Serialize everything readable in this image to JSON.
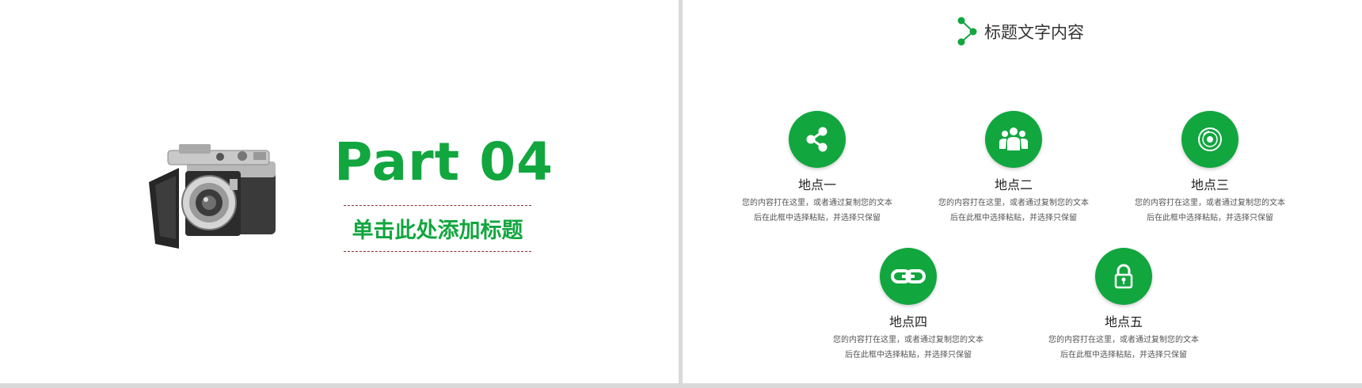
{
  "left_slide": {
    "title": "Part   04",
    "subtitle": "单击此处添加标题",
    "image": "camera-photo"
  },
  "right_slide": {
    "header_icon": "branch-nodes-icon",
    "header_title": "标题文字内容",
    "colors": {
      "accent": "#12a63f",
      "text": "#333333",
      "desc": "#555555"
    },
    "locations": [
      {
        "icon": "share-icon",
        "title": "地点一",
        "desc_line1": "您的内容打在这里，或者通过复制您的文本",
        "desc_line2": "后在此框中选择粘贴，并选择只保留"
      },
      {
        "icon": "group-people-icon",
        "title": "地点二",
        "desc_line1": "您的内容打在这里，或者通过复制您的文本",
        "desc_line2": "后在此框中选择粘贴，并选择只保留"
      },
      {
        "icon": "disc-icon",
        "title": "地点三",
        "desc_line1": "您的内容打在这里，或者通过复制您的文本",
        "desc_line2": "后在此框中选择粘贴，并选择只保留"
      },
      {
        "icon": "link-icon",
        "title": "地点四",
        "desc_line1": "您的内容打在这里，或者通过复制您的文本",
        "desc_line2": "后在此框中选择粘贴，并选择只保留"
      },
      {
        "icon": "lock-icon",
        "title": "地点五",
        "desc_line1": "您的内容打在这里，或者通过复制您的文本",
        "desc_line2": "后在此框中选择粘贴，并选择只保留"
      }
    ]
  }
}
